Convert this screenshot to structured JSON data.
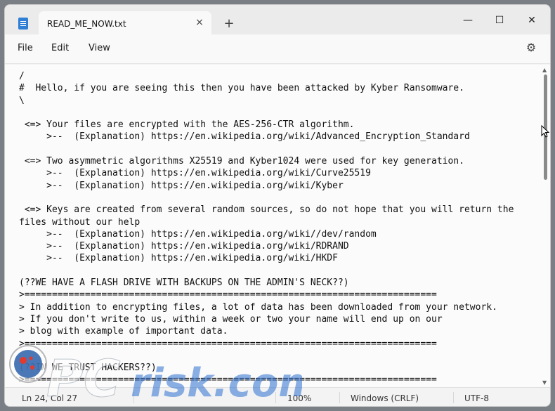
{
  "tab": {
    "title": "READ_ME_NOW.txt",
    "close_icon": "×",
    "new_tab_icon": "+"
  },
  "window_controls": {
    "minimize": "—",
    "maximize": "☐",
    "close": "✕"
  },
  "menu": {
    "file": "File",
    "edit": "Edit",
    "view": "View",
    "settings_icon": "⚙"
  },
  "editor": {
    "lines": [
      "/",
      "#  Hello, if you are seeing this then you have been attacked by Kyber Ransomware.",
      "\\",
      "",
      " <=> Your files are encrypted with the AES-256-CTR algorithm.",
      "     >--  (Explanation) https://en.wikipedia.org/wiki/Advanced_Encryption_Standard",
      "",
      " <=> Two asymmetric algorithms X25519 and Kyber1024 were used for key generation.",
      "     >--  (Explanation) https://en.wikipedia.org/wiki/Curve25519",
      "     >--  (Explanation) https://en.wikipedia.org/wiki/Kyber",
      "",
      " <=> Keys are created from several random sources, so do not hope that you will return the",
      "files without our help",
      "     >--  (Explanation) https://en.wikipedia.org/wiki//dev/random",
      "     >--  (Explanation) https://en.wikipedia.org/wiki/RDRAND",
      "     >--  (Explanation) https://en.wikipedia.org/wiki/HKDF",
      "",
      "(??WE HAVE A FLASH DRIVE WITH BACKUPS ON THE ADMIN'S NECK??)",
      ">===========================================================================",
      "> In addition to encrypting files, a lot of data has been downloaded from your network.",
      "> If you don't write to us, within a week or two your name will end up on our",
      "> blog with example of important data.",
      ">===========================================================================",
      "",
      "(??IN WE TRUST HACKERS??)",
      ">==========================================================================="
    ]
  },
  "status": {
    "position": "Ln 24, Col 27",
    "chars": "",
    "zoom": "100%",
    "line_ending": "Windows (CRLF)",
    "encoding": "UTF-8"
  },
  "watermark": {
    "text": "risk.com",
    "prefix": "PC"
  }
}
